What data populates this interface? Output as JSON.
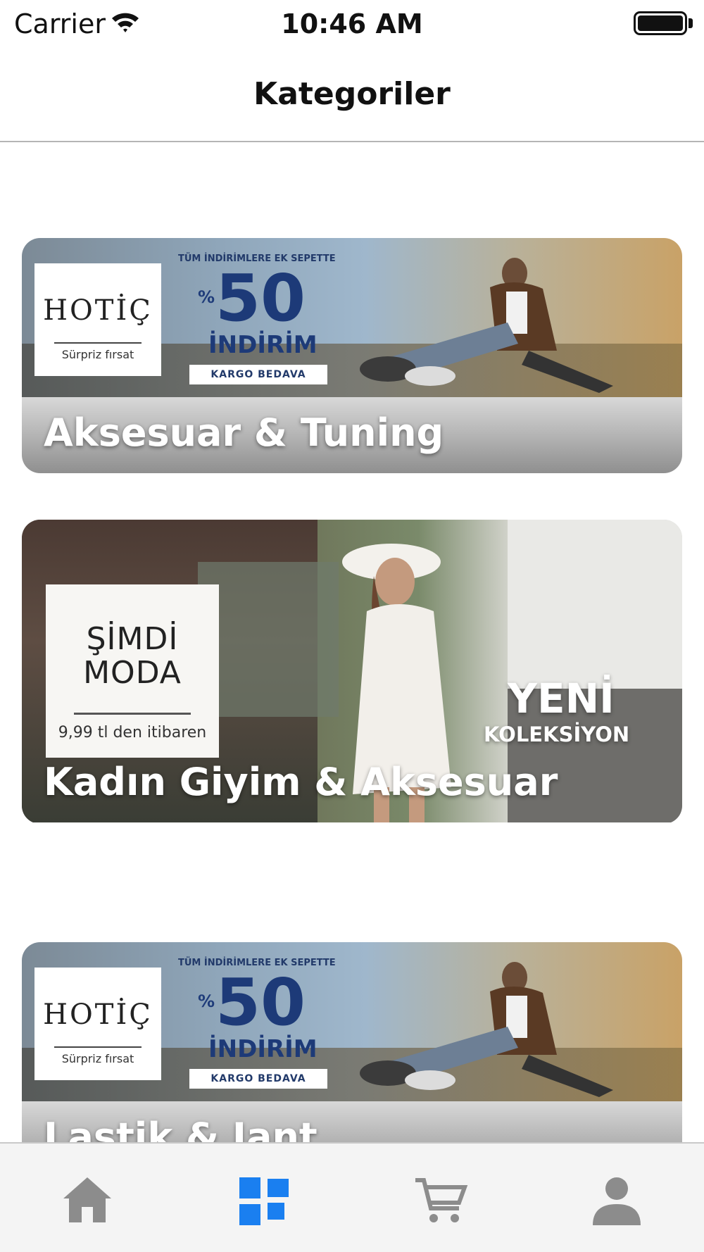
{
  "status_bar": {
    "carrier": "Carrier",
    "time": "10:46 AM",
    "icons": [
      "wifi-icon",
      "battery-icon"
    ]
  },
  "nav": {
    "title": "Kategoriler"
  },
  "categories": [
    {
      "title": "Aksesuar & Tuning",
      "banner": {
        "logo": "HOTİÇ",
        "logo_sub": "Sürpriz fırsat",
        "top_text": "TÜM İNDİRİMLERE EK SEPETTE",
        "percent_sign": "%",
        "percent": "50",
        "discount": "İNDİRİM",
        "shipping": "KARGO BEDAVA"
      }
    },
    {
      "title": "Kadın Giyim & Aksesuar",
      "banner": {
        "headline_line1": "ŞİMDİ",
        "headline_line2": "MODA",
        "sub": "9,99 tl den itibaren",
        "yeni": "YENİ",
        "koleksiyon": "KOLEKSİYON"
      }
    },
    {
      "title": "Lastik & Jant",
      "banner": {
        "logo": "HOTİÇ",
        "logo_sub": "Sürpriz fırsat",
        "top_text": "TÜM İNDİRİMLERE EK SEPETTE",
        "percent_sign": "%",
        "percent": "50",
        "discount": "İNDİRİM",
        "shipping": "KARGO BEDAVA"
      }
    }
  ],
  "tab_bar": {
    "tabs": [
      {
        "icon": "home-icon",
        "selected": false
      },
      {
        "icon": "categories-icon",
        "selected": true
      },
      {
        "icon": "cart-icon",
        "selected": false
      },
      {
        "icon": "profile-icon",
        "selected": false
      }
    ],
    "active_color": "#1a7ff0",
    "inactive_color": "#8c8c8c"
  }
}
